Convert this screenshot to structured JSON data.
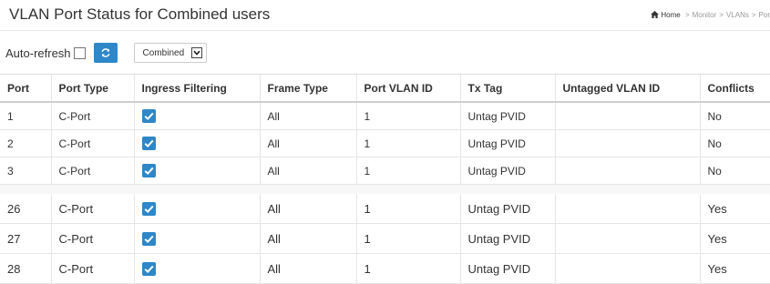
{
  "header": {
    "title": "VLAN Port Status for Combined users",
    "breadcrumb": [
      "Home",
      "Monitor",
      "VLANs",
      "Por"
    ]
  },
  "controls": {
    "auto_refresh_label": "Auto-refresh",
    "auto_refresh_checked": false,
    "user_select_value": "Combined"
  },
  "table": {
    "columns": [
      "Port",
      "Port Type",
      "Ingress Filtering",
      "Frame Type",
      "Port VLAN ID",
      "Tx Tag",
      "Untagged VLAN ID",
      "Conflicts"
    ],
    "rows_top": [
      {
        "port": "1",
        "port_type": "C-Port",
        "ingress_filtering": true,
        "frame_type": "All",
        "pvid": "1",
        "tx_tag": "Untag PVID",
        "untagged_vlan": "",
        "conflicts": "No"
      },
      {
        "port": "2",
        "port_type": "C-Port",
        "ingress_filtering": true,
        "frame_type": "All",
        "pvid": "1",
        "tx_tag": "Untag PVID",
        "untagged_vlan": "",
        "conflicts": "No"
      },
      {
        "port": "3",
        "port_type": "C-Port",
        "ingress_filtering": true,
        "frame_type": "All",
        "pvid": "1",
        "tx_tag": "Untag PVID",
        "untagged_vlan": "",
        "conflicts": "No"
      }
    ],
    "rows_bottom": [
      {
        "port": "26",
        "port_type": "C-Port",
        "ingress_filtering": true,
        "frame_type": "All",
        "pvid": "1",
        "tx_tag": "Untag PVID",
        "untagged_vlan": "",
        "conflicts": "Yes"
      },
      {
        "port": "27",
        "port_type": "C-Port",
        "ingress_filtering": true,
        "frame_type": "All",
        "pvid": "1",
        "tx_tag": "Untag PVID",
        "untagged_vlan": "",
        "conflicts": "Yes"
      },
      {
        "port": "28",
        "port_type": "C-Port",
        "ingress_filtering": true,
        "frame_type": "All",
        "pvid": "1",
        "tx_tag": "Untag PVID",
        "untagged_vlan": "",
        "conflicts": "Yes"
      }
    ]
  },
  "colors": {
    "accent": "#2e87c8"
  },
  "icons": {
    "home": "home-icon",
    "refresh": "refresh-icon",
    "checkbox": "checkbox-checked-icon",
    "dropdown": "chevron-down-icon"
  }
}
